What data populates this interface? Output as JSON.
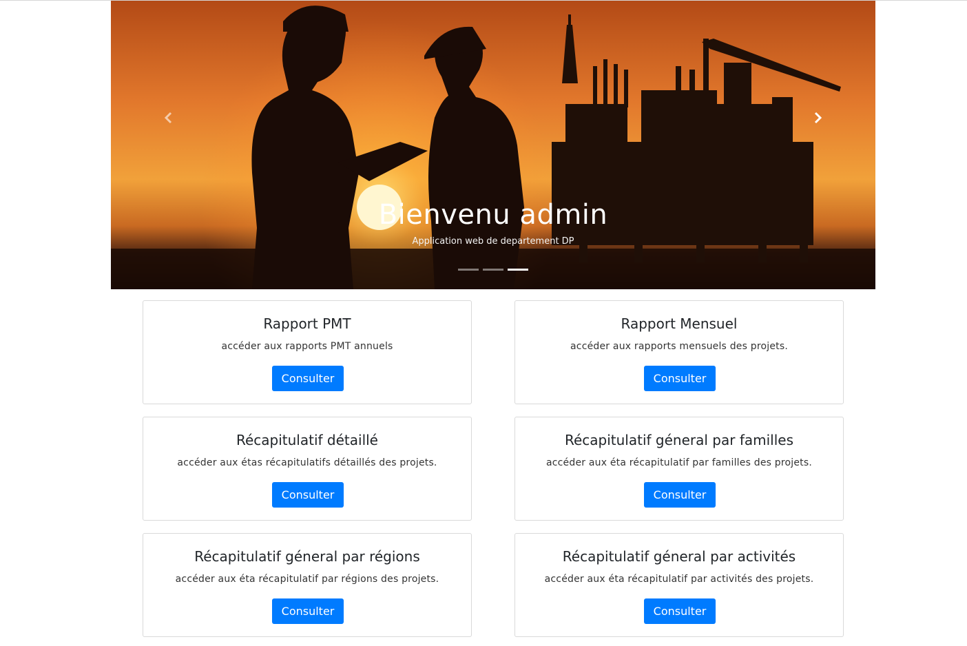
{
  "carousel": {
    "title": "Bienvenu admin",
    "subtitle": "Application web de departement DP",
    "prev_icon": "chevron-left-icon",
    "next_icon": "chevron-right-icon",
    "indicators_count": 3,
    "active_indicator": 3
  },
  "cards": [
    {
      "title": "Rapport PMT",
      "description": "accéder aux rapports PMT annuels",
      "button": "Consulter"
    },
    {
      "title": "Rapport Mensuel",
      "description": "accéder aux rapports mensuels des projets.",
      "button": "Consulter"
    },
    {
      "title": "Récapitulatif détaillé",
      "description": "accéder aux étas récapitulatifs détaillés des projets.",
      "button": "Consulter"
    },
    {
      "title": "Récapitulatif géneral par familles",
      "description": "accéder aux éta récapitulatif par familles des projets.",
      "button": "Consulter"
    },
    {
      "title": "Récapitulatif géneral par régions",
      "description": "accéder aux éta récapitulatif par régions des projets.",
      "button": "Consulter"
    },
    {
      "title": "Récapitulatif géneral par activités",
      "description": "accéder aux éta récapitulatif par activités des projets.",
      "button": "Consulter"
    }
  ],
  "colors": {
    "button": "#007bff",
    "card_border": "#d9d9d9",
    "sunset_top": "#e07a2e",
    "sunset_bottom": "#1c0a04"
  }
}
